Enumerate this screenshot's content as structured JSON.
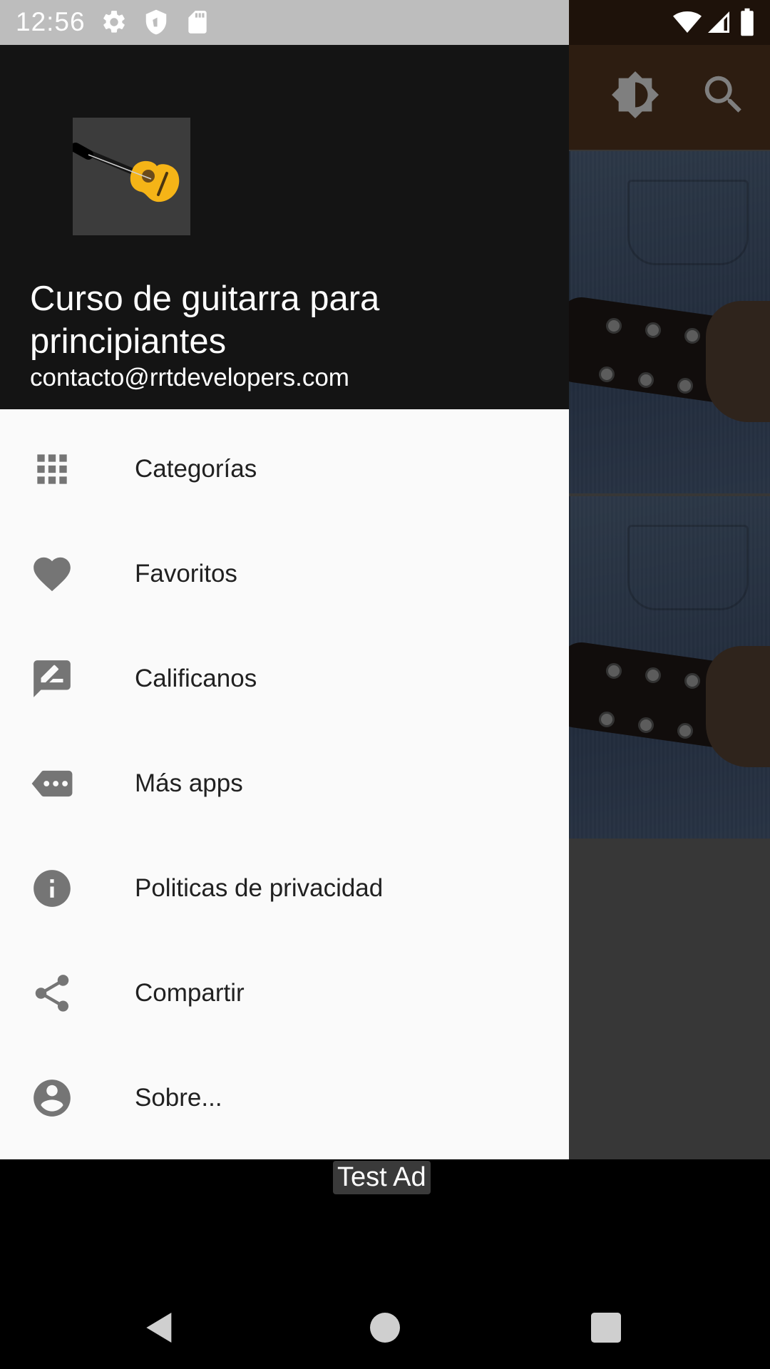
{
  "status_bar": {
    "time": "12:56",
    "left_icons": [
      "gear-icon",
      "shield-icon",
      "sd-card-icon"
    ],
    "right_icons": [
      "wifi-icon",
      "signal-icon",
      "battery-icon"
    ]
  },
  "background_app": {
    "toolbar_icons": [
      "brightness-icon",
      "search-icon"
    ],
    "accent_color": "#5a3a22"
  },
  "drawer": {
    "title": "Curso de guitarra para principiantes",
    "email": "contacto@rrtdevelopers.com",
    "header_color": "#141414",
    "items": [
      {
        "label": "Categorías",
        "icon": "grid-icon"
      },
      {
        "label": "Favoritos",
        "icon": "heart-icon"
      },
      {
        "label": "Calificanos",
        "icon": "rate-review-icon"
      },
      {
        "label": "Más apps",
        "icon": "more-apps-icon"
      },
      {
        "label": "Politicas de privacidad",
        "icon": "info-icon"
      },
      {
        "label": "Compartir",
        "icon": "share-icon"
      },
      {
        "label": "Sobre...",
        "icon": "account-circle-icon"
      }
    ]
  },
  "ad": {
    "label": "Test Ad"
  },
  "nav_bar": {
    "buttons": [
      "back-icon",
      "home-icon",
      "recents-icon"
    ]
  }
}
